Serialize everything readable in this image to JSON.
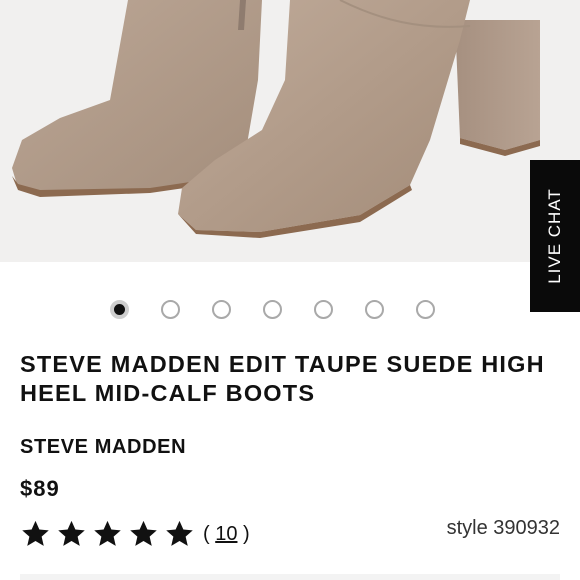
{
  "live_chat": {
    "label": "LIVE CHAT"
  },
  "carousel": {
    "total_images": 7,
    "active_index": 0
  },
  "product": {
    "title": "STEVE MADDEN EDIT TAUPE SUEDE HIGH HEEL MID-CALF BOOTS",
    "brand": "STEVE MADDEN",
    "price": "$89",
    "rating_stars": 5,
    "review_count_open": "( ",
    "review_count": "10",
    "review_count_close": " )",
    "style_label": "style 390932"
  },
  "colors": {
    "suede": "#b49e8c",
    "sole": "#8c6a50",
    "text": "#111111",
    "chat_bg": "#0a0a0a"
  },
  "icons": {
    "star": "star-icon"
  }
}
